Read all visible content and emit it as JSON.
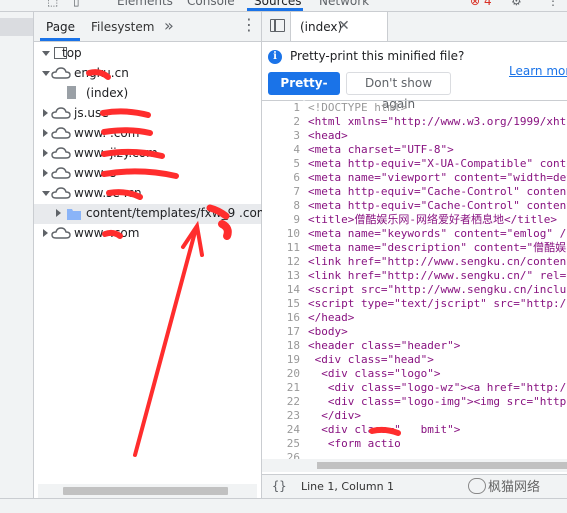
{
  "topbar": {
    "tabs": [
      "Elements",
      "Console",
      "Sources",
      "Network"
    ],
    "badge": "4"
  },
  "navigator": {
    "tabs": {
      "page": "Page",
      "filesystem": "Filesystem"
    },
    "more": "»",
    "tree": [
      {
        "label": "top"
      },
      {
        "label": "engku.cn"
      },
      {
        "label": "(index)"
      },
      {
        "label": "js.use"
      },
      {
        "label": "www.   .com"
      },
      {
        "label": "www.   jizy.com"
      },
      {
        "label": "www.   s"
      },
      {
        "label": "www.se    .cn"
      },
      {
        "label": "content/templates/fxw_9   .com"
      },
      {
        "label": "www.   .com"
      }
    ]
  },
  "editor": {
    "tab_label": "(index)",
    "info_text": "Pretty-print this minified file?",
    "learn_more": "Learn more",
    "pretty_print": "Pretty-print",
    "dont_show": "Don't show again",
    "lines": [
      "<!DOCTYPE html>",
      "<html xmlns=\"http://www.w3.org/1999/xht",
      "<head>",
      "<meta charset=\"UTF-8\">",
      "<meta http-equiv=\"X-UA-Compatible\" conte",
      "<meta name=\"viewport\" content=\"width=dev",
      "<meta http-equiv=\"Cache-Control\" content",
      "<meta http-equiv=\"Cache-Control\" content",
      "<title>僧酷娱乐网-网络爱好者栖息地</title>",
      "<meta name=\"keywords\" content=\"emlog\" /",
      "<meta name=\"description\" content=\"僧酷娱",
      "<link href=\"http://www.sengku.cn/content",
      "<link href=\"http://www.sengku.cn/\" rel=",
      "<script src=\"http://www.sengku.cn/inclu",
      "<script type=\"text/jscript\" src=\"http:/",
      "</head>",
      "<body>",
      "<header class=\"header\">",
      " <div class=\"head\">",
      "  <div class=\"logo\">",
      "   <div class=\"logo-wz\"><a href=\"http:/",
      "   <div class=\"logo-img\"><img src=\"http",
      "  </div>",
      "  <div class=\"   bmit\">",
      "   <form actio",
      "   "
    ],
    "status_braces": "{}",
    "status_position": "Line 1, Column 1"
  },
  "watermark": "枫猫网络",
  "colors": {
    "accent": "#1a73e8",
    "annotation": "#ff2d2d"
  }
}
